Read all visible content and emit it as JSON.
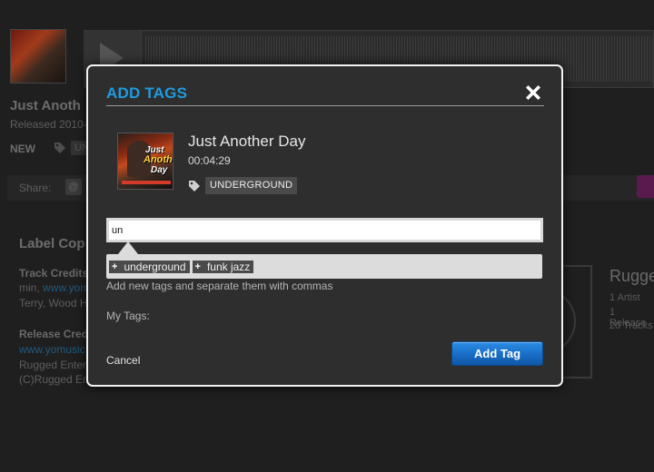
{
  "background": {
    "release_title": "Just Anoth",
    "released": "Released 2010-",
    "new_label": "NEW",
    "tag_partial": "UN",
    "share_label": "Share:",
    "at_glyph": "@",
    "label_copy_heading": "Label Cop",
    "track_credits_heading": "Track Credits",
    "track_credits_line1_prefix": "min, ",
    "track_credits_line1_link": "www.yom",
    "track_credits_line2": "Terry, Wood H",
    "release_credits_heading": "Release Cred",
    "release_link": "www.yomusic",
    "release_line2": "Rugged Enter",
    "release_line3": "(C)Rugged Er",
    "artist_name": "Rugge",
    "stats": [
      "1 Artist",
      "1 Release",
      "20 Tracks"
    ]
  },
  "modal": {
    "title": "ADD TAGS",
    "close_icon": "close-x-icon",
    "track": {
      "title": "Just Another Day",
      "duration": "00:04:29",
      "tag": "UNDERGROUND",
      "art_text": [
        "Just",
        "Another",
        "Day"
      ]
    },
    "input": {
      "value": "un",
      "placeholder": ""
    },
    "suggestions": [
      {
        "plus": "+",
        "label": "underground"
      },
      {
        "plus": "+",
        "label": "funk jazz"
      }
    ],
    "hint": "Add new tags and separate them with commas",
    "my_tags_label": "My Tags:",
    "cancel_label": "Cancel",
    "add_button_label": "Add Tag"
  },
  "colors": {
    "accent": "#1e9be0",
    "button_blue": "#1a6fc9",
    "modal_bg": "#2e2e2e",
    "tag_bg": "#4a4a4a"
  }
}
